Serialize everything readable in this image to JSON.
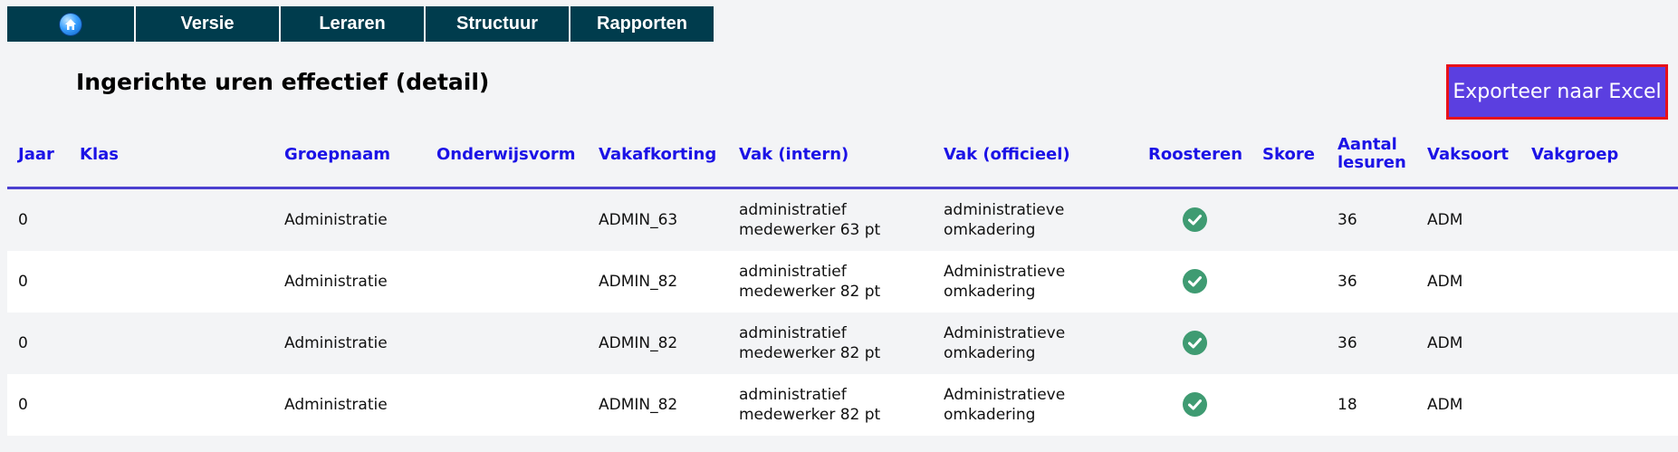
{
  "nav": {
    "items": [
      {
        "label": "Versie"
      },
      {
        "label": "Leraren"
      },
      {
        "label": "Structuur"
      },
      {
        "label": "Rapporten"
      }
    ]
  },
  "page": {
    "title": "Ingerichte uren effectief (detail)",
    "export_label": "Exporteer naar Excel"
  },
  "table": {
    "headers": {
      "jaar": "Jaar",
      "klas": "Klas",
      "groepnaam": "Groepnaam",
      "onderwijsvorm": "Onderwijsvorm",
      "vakafkorting": "Vakafkorting",
      "vak_intern": "Vak (intern)",
      "vak_officieel": "Vak (officieel)",
      "roosteren": "Roosteren",
      "skore": "Skore",
      "aantal_lesuren_1": "Aantal",
      "aantal_lesuren_2": "lesuren",
      "vaksoort": "Vaksoort",
      "vakgroep": "Vakgroep"
    },
    "rows": [
      {
        "jaar": "0",
        "klas": "",
        "groepnaam": "Administratie",
        "onderwijsvorm": "",
        "vakafkorting": "ADMIN_63",
        "vak_intern_1": "administratief",
        "vak_intern_2": "medewerker 63 pt",
        "vak_officieel_1": "administratieve",
        "vak_officieel_2": "omkadering",
        "roosteren": true,
        "skore": "",
        "aantal_lesuren": "36",
        "vaksoort": "ADM",
        "vakgroep": ""
      },
      {
        "jaar": "0",
        "klas": "",
        "groepnaam": "Administratie",
        "onderwijsvorm": "",
        "vakafkorting": "ADMIN_82",
        "vak_intern_1": "administratief",
        "vak_intern_2": "medewerker 82 pt",
        "vak_officieel_1": "Administratieve",
        "vak_officieel_2": "omkadering",
        "roosteren": true,
        "skore": "",
        "aantal_lesuren": "36",
        "vaksoort": "ADM",
        "vakgroep": ""
      },
      {
        "jaar": "0",
        "klas": "",
        "groepnaam": "Administratie",
        "onderwijsvorm": "",
        "vakafkorting": "ADMIN_82",
        "vak_intern_1": "administratief",
        "vak_intern_2": "medewerker 82 pt",
        "vak_officieel_1": "Administratieve",
        "vak_officieel_2": "omkadering",
        "roosteren": true,
        "skore": "",
        "aantal_lesuren": "36",
        "vaksoort": "ADM",
        "vakgroep": ""
      },
      {
        "jaar": "0",
        "klas": "",
        "groepnaam": "Administratie",
        "onderwijsvorm": "",
        "vakafkorting": "ADMIN_82",
        "vak_intern_1": "administratief",
        "vak_intern_2": "medewerker 82 pt",
        "vak_officieel_1": "Administratieve",
        "vak_officieel_2": "omkadering",
        "roosteren": true,
        "skore": "",
        "aantal_lesuren": "18",
        "vaksoort": "ADM",
        "vakgroep": ""
      }
    ]
  },
  "icons": {
    "home": "home-icon",
    "check": "check-circle-icon"
  },
  "colors": {
    "nav_bg": "#003c4d",
    "header_text": "#1b12e6",
    "export_bg": "#5b3fe0",
    "export_border": "#e8101a",
    "check": "#3f9b72"
  }
}
